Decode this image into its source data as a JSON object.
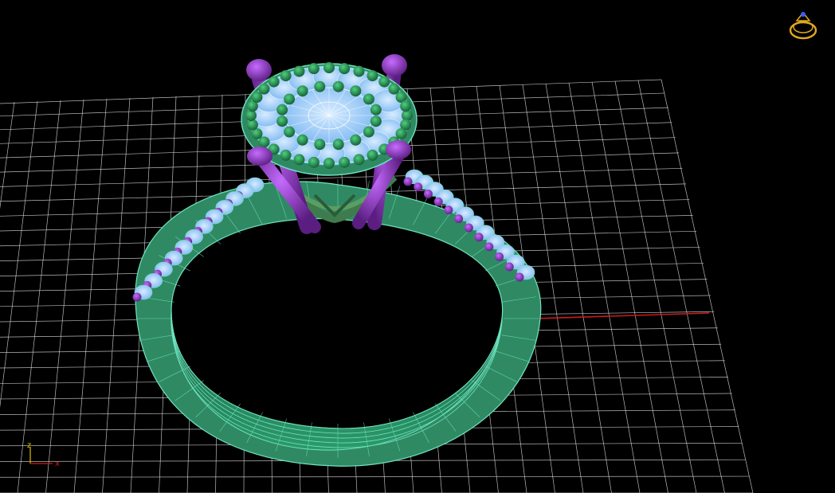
{
  "viewport": {
    "background": "#000000",
    "grid_color": "#d9d9d9",
    "model_colors": {
      "shank": "#2f8a63",
      "wire": "#6fe3c0",
      "stone": "#9fd2ff",
      "prong": "#7a2aa3",
      "bead": "#1f7a4a",
      "gallery": "#3f7b4c"
    },
    "world_axes": {
      "x_color": "#cc1b1b",
      "y_color": "#15a6c8"
    }
  },
  "triad": {
    "z_label": "z",
    "x_label": "x",
    "z_color": "#e0c000",
    "x_color": "#cc1b1b"
  },
  "view_cube": {
    "icon": "ring-icon",
    "color": "#e0a820"
  }
}
